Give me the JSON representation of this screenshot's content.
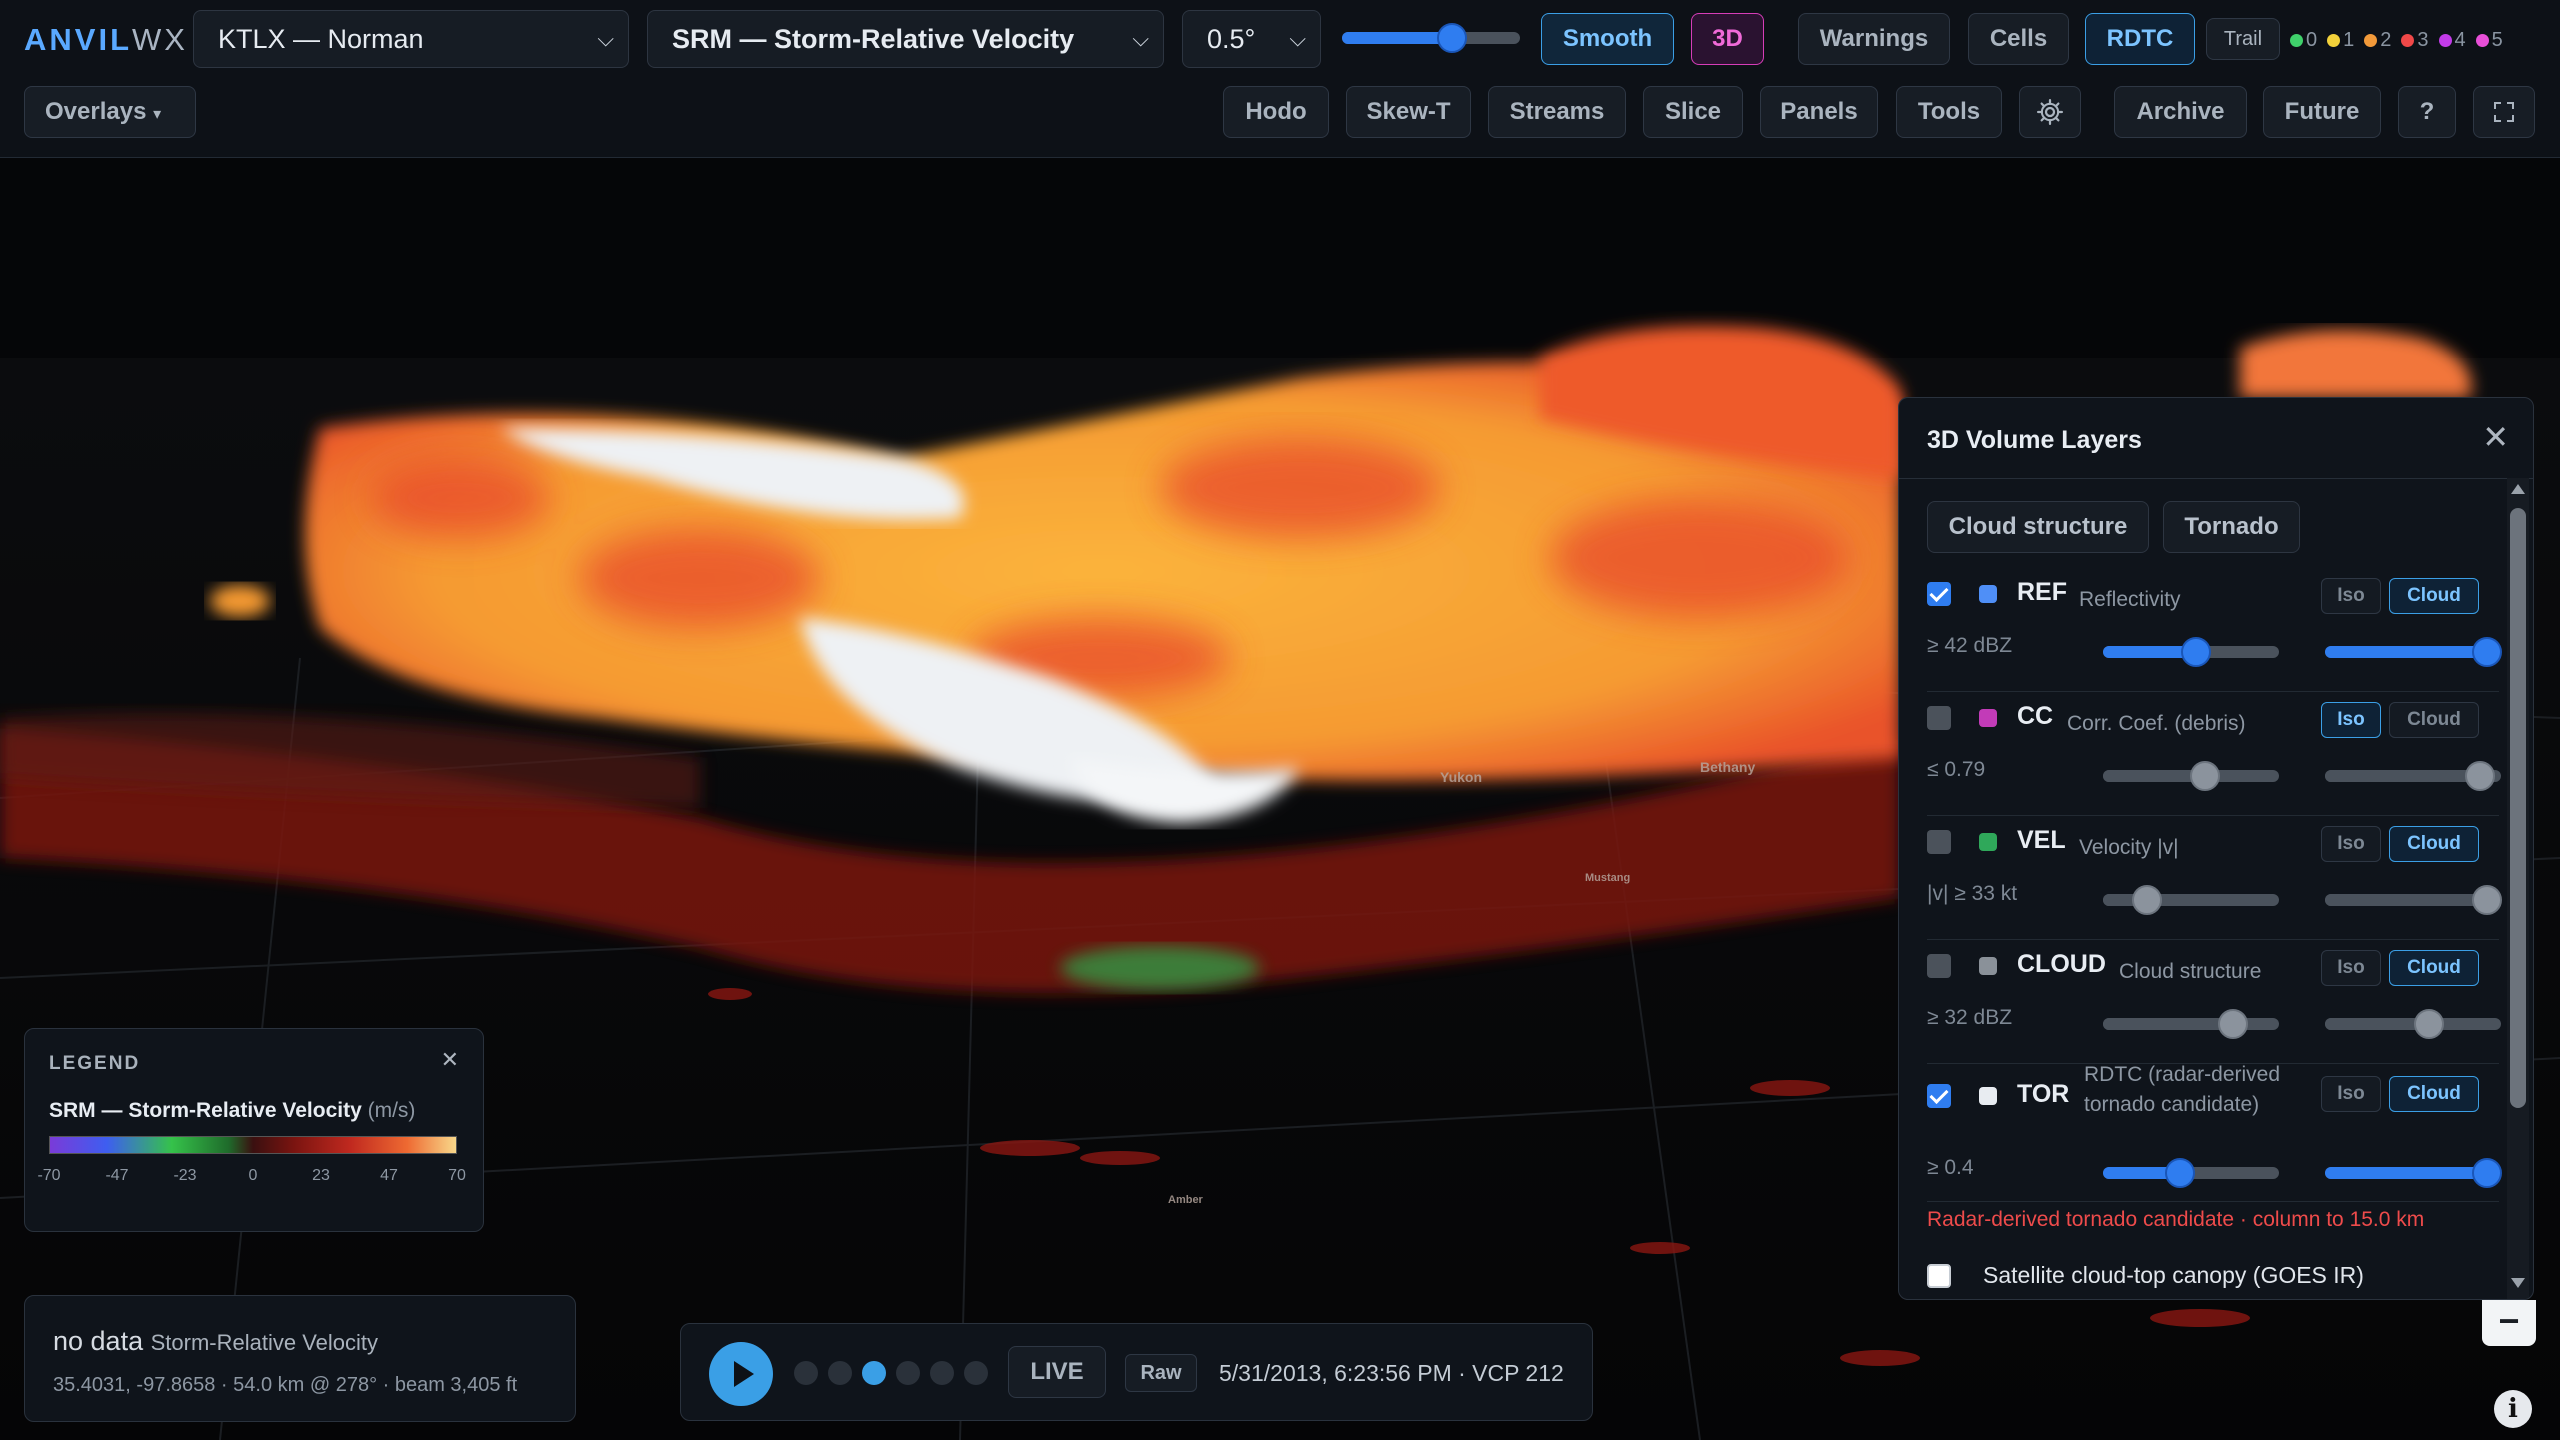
{
  "app": {
    "brand_a": "ANVIL",
    "brand_b": "WX"
  },
  "toolbar": {
    "station": "KTLX — Norman",
    "product": "SRM — Storm-Relative Velocity",
    "tilt": "0.5°",
    "opacity_level": 0.62,
    "smooth": "Smooth",
    "three_d": "3D",
    "warnings": "Warnings",
    "cells": "Cells",
    "rdtc": "RDTC",
    "trail": "Trail",
    "hail_levels": [
      {
        "label": "0",
        "color": "#3fd16b"
      },
      {
        "label": "1",
        "color": "#f2d13a"
      },
      {
        "label": "2",
        "color": "#f29a3a"
      },
      {
        "label": "3",
        "color": "#f04848"
      },
      {
        "label": "4",
        "color": "#c23be8"
      },
      {
        "label": "5",
        "color": "#e84fd8"
      }
    ],
    "overlays": "Overlays",
    "overlays_caret": "▾",
    "hodo": "Hodo",
    "skewt": "Skew-T",
    "streams": "Streams",
    "slice": "Slice",
    "panels": "Panels",
    "tools": "Tools",
    "archive": "Archive",
    "future": "Future",
    "help": "?"
  },
  "map_labels": {
    "yukon": "Yukon",
    "bethany": "Bethany",
    "mustang": "Mustang",
    "amber": "Amber"
  },
  "volume_panel": {
    "title": "3D Volume Layers",
    "close": "✕",
    "presets": [
      "Cloud structure",
      "Tornado"
    ],
    "layers": [
      {
        "code": "REF",
        "desc": "Reflectivity",
        "threshold": "≥ 42 dBZ",
        "checked": true,
        "swatch": "#4f8ff7",
        "mode": "Cloud",
        "thr_level": 0.53,
        "op_level": 0.92
      },
      {
        "code": "CC",
        "desc": "Corr. Coef. (debris)",
        "threshold": "≤ 0.79",
        "checked": false,
        "swatch": "#c23bb8",
        "mode": "Iso",
        "thr_level": 0.58,
        "op_level": 0.88
      },
      {
        "code": "VEL",
        "desc": "Velocity |v|",
        "threshold": "|v| ≥ 33 kt",
        "checked": false,
        "swatch": "#2fa85a",
        "mode": "Cloud",
        "thr_level": 0.25,
        "op_level": 0.92
      },
      {
        "code": "CLOUD",
        "desc": "Cloud structure",
        "threshold": "≥ 32 dBZ",
        "checked": false,
        "swatch": "#8a9199",
        "mode": "Cloud",
        "thr_level": 0.74,
        "op_level": 0.59
      },
      {
        "code": "TOR",
        "desc": "RDTC (radar-derived\ntornado candidate)",
        "threshold": "≥ 0.4",
        "checked": true,
        "swatch": "#e8ecf1",
        "mode": "Cloud",
        "thr_level": 0.44,
        "op_level": 0.92
      }
    ],
    "iso": "Iso",
    "cloud": "Cloud",
    "tor_note": "Radar-derived tornado candidate · column to 15.0 km",
    "satellite": "Satellite cloud-top canopy (GOES IR)"
  },
  "legend": {
    "heading": "LEGEND",
    "close": "✕",
    "product": "SRM — Storm-Relative Velocity",
    "unit": "(m/s)",
    "ticks": [
      "-70",
      "-47",
      "-23",
      "0",
      "23",
      "47",
      "70"
    ]
  },
  "readout": {
    "value": "no data",
    "product": "Storm-Relative Velocity",
    "detail": "35.4031, -97.8658 · 54.0 km @ 278° · beam 3,405 ft"
  },
  "player": {
    "live": "LIVE",
    "raw": "Raw",
    "timestamp": "5/31/2013, 6:23:56 PM · VCP 212",
    "frames": 6,
    "active_frame": 2
  },
  "zoom_out": "−",
  "info": "i"
}
